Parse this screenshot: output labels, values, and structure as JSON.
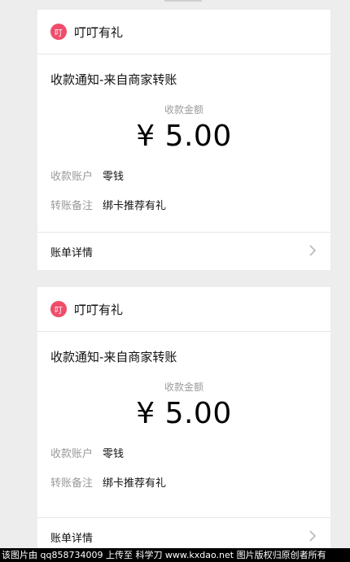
{
  "cards": [
    {
      "brand": "叮叮有礼",
      "logo_char": "叮",
      "title": "收款通知-来自商家转账",
      "amount_label": "收款金额",
      "amount": "¥ 5.00",
      "account_label": "收款账户",
      "account_value": "零钱",
      "remark_label": "转账备注",
      "remark_value": "绑卡推荐有礼",
      "detail_label": "账单详情"
    },
    {
      "brand": "叮叮有礼",
      "logo_char": "叮",
      "title": "收款通知-来自商家转账",
      "amount_label": "收款金额",
      "amount": "¥ 5.00",
      "account_label": "收款账户",
      "account_value": "零钱",
      "remark_label": "转账备注",
      "remark_value": "绑卡推荐有礼",
      "detail_label": "账单详情"
    }
  ],
  "watermark": "该图片由 qq858734009 上传至 科学刀 www.kxdao.net 图片版权归原创者所有",
  "colors": {
    "background": "#ededed",
    "logo": "#f04d6b",
    "banner": "#000000"
  }
}
